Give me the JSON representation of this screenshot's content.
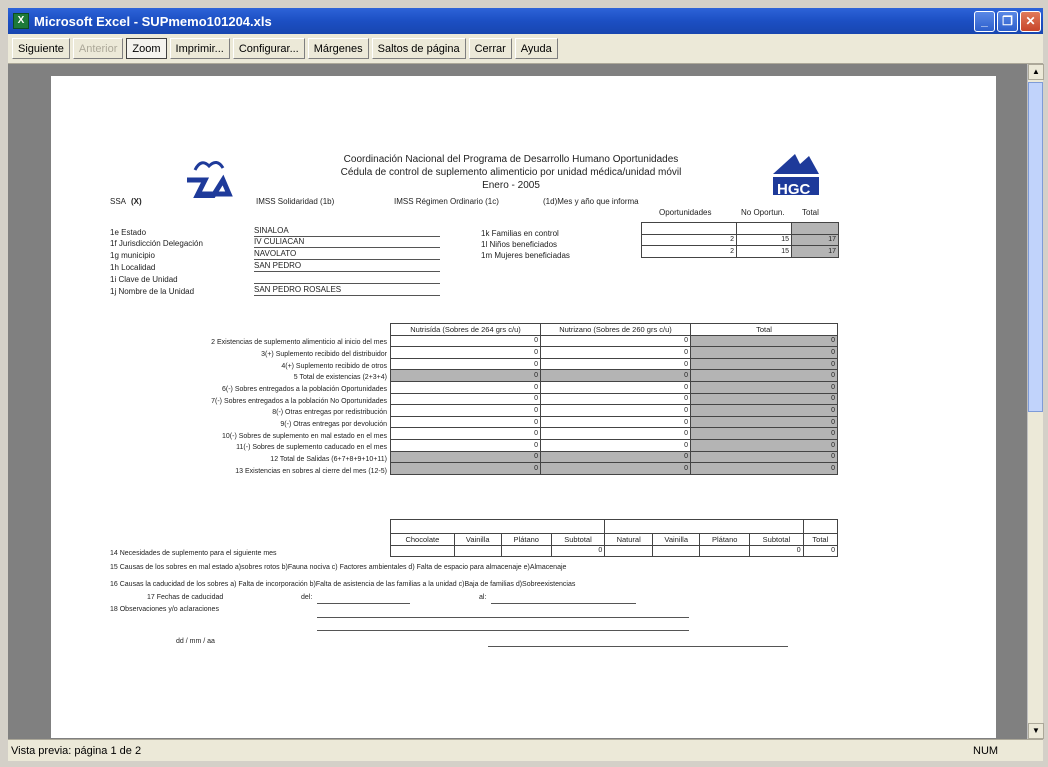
{
  "window": {
    "title": "Microsoft Excel - SUPmemo101204.xls",
    "app_icon": "X",
    "minimize": "_",
    "restore": "❐",
    "close": "✕"
  },
  "toolbar": {
    "buttons": [
      "Siguiente",
      "Anterior",
      "Zoom",
      "Imprimir...",
      "Configurar...",
      "Márgenes",
      "Saltos de página",
      "Cerrar",
      "Ayuda"
    ]
  },
  "status": {
    "text": "Vista previa: página 1 de 2",
    "num": "NUM"
  },
  "sheet": {
    "header_lines": [
      "Coordinación Nacional del Programa de Desarrollo Humano Oportunidades",
      "Cédula de control de suplemento alimenticio por unidad médica/unidad móvil",
      "Enero - 2005"
    ],
    "logo_right": "HGC",
    "ssa": "SSA",
    "ssa_mark": "(X)",
    "imss_sol": "IMSS Solidaridad (1b)",
    "imss_reg": "IMSS Régimen Ordinario (1c)",
    "mes": "(1d)Mes y año que informa",
    "fields": [
      {
        "label": "1e Estado",
        "value": "SINALOA"
      },
      {
        "label": "1f Jurisdicción Delegación",
        "value": "IV CULIACAN"
      },
      {
        "label": "1g municipio",
        "value": "NAVOLATO"
      },
      {
        "label": "1h Localidad",
        "value": "SAN PEDRO"
      },
      {
        "label": "1i Clave de Unidad",
        "value": ""
      },
      {
        "label": "1j Nombre de la Unidad",
        "value": "SAN PEDRO ROSALES"
      }
    ],
    "fam_cols": [
      "Oportunidades",
      "No Oportun.",
      "Total"
    ],
    "fam_rows": [
      {
        "label": "1k Familias en control",
        "v": [
          "",
          "",
          ""
        ]
      },
      {
        "label": "1l Niños beneficiados",
        "v": [
          "2",
          "15",
          "17"
        ]
      },
      {
        "label": "1m Mujeres beneficiadas",
        "v": [
          "2",
          "15",
          "17"
        ]
      }
    ],
    "main_cols": [
      "Nutrisída (Sobres de 264 grs c/u)",
      "Nutrizano (Sobres de 260 grs c/u)",
      "Total"
    ],
    "main_rows": [
      {
        "label": "2 Existencias de suplemento alimenticio al inicio del mes",
        "v": [
          "0",
          "0",
          "0"
        ]
      },
      {
        "label": "3(+) Suplemento recibido del distribuidor",
        "v": [
          "0",
          "0",
          "0"
        ]
      },
      {
        "label": "4(+) Suplemento recibido de otros",
        "v": [
          "0",
          "0",
          "0"
        ]
      },
      {
        "label": "5 Total de existencias (2+3+4)",
        "v": [
          "0",
          "0",
          "0"
        ]
      },
      {
        "label": "6(-) Sobres entregados a la población Oportunidades",
        "v": [
          "0",
          "0",
          "0"
        ]
      },
      {
        "label": "7(-) Sobres entregados a la población No Oportunidades",
        "v": [
          "0",
          "0",
          "0"
        ]
      },
      {
        "label": "8(-) Otras entregas por redistribución",
        "v": [
          "0",
          "0",
          "0"
        ]
      },
      {
        "label": "9(-) Otras entregas por devolución",
        "v": [
          "0",
          "0",
          "0"
        ]
      },
      {
        "label": "10(-) Sobres de suplemento en mal estado en el mes",
        "v": [
          "0",
          "0",
          "0"
        ]
      },
      {
        "label": "11(-) Sobres de suplemento caducado en el mes",
        "v": [
          "0",
          "0",
          "0"
        ]
      },
      {
        "label": "12 Total de Salidas (6+7+8+9+10+11)",
        "v": [
          "0",
          "0",
          "0"
        ]
      },
      {
        "label": "13 Existencias en sobres al cierre del mes (12-5)",
        "v": [
          "0",
          "0",
          "0"
        ]
      }
    ],
    "need_cols": [
      "Chocolate",
      "Vainilla",
      "Plátano",
      "Subtotal",
      "Natural",
      "Vainilla",
      "Plátano",
      "Subtotal",
      "Total"
    ],
    "need_vals": [
      "",
      "",
      "",
      "0",
      "",
      "",
      "",
      "0",
      "0"
    ],
    "line14": "14 Necesidades de suplemento para el siguiente mes",
    "line15": "15 Causas de los sobres en mal estado a)sobres rotos b)Fauna nociva c) Factores ambientales d) Falta de espacio para almacenaje e)Almacenaje",
    "line16": "16 Causas la caducidad de los sobres a) Falta de incorporación b)Falta de asistencia de las familias a la unidad c)Baja de familias d)Sobreexistencias",
    "line17": "17 Fechas de caducidad",
    "del": "del:",
    "al": "al:",
    "line18": "18 Observaciones y/o aclaraciones",
    "date": "dd / mm / aa"
  }
}
